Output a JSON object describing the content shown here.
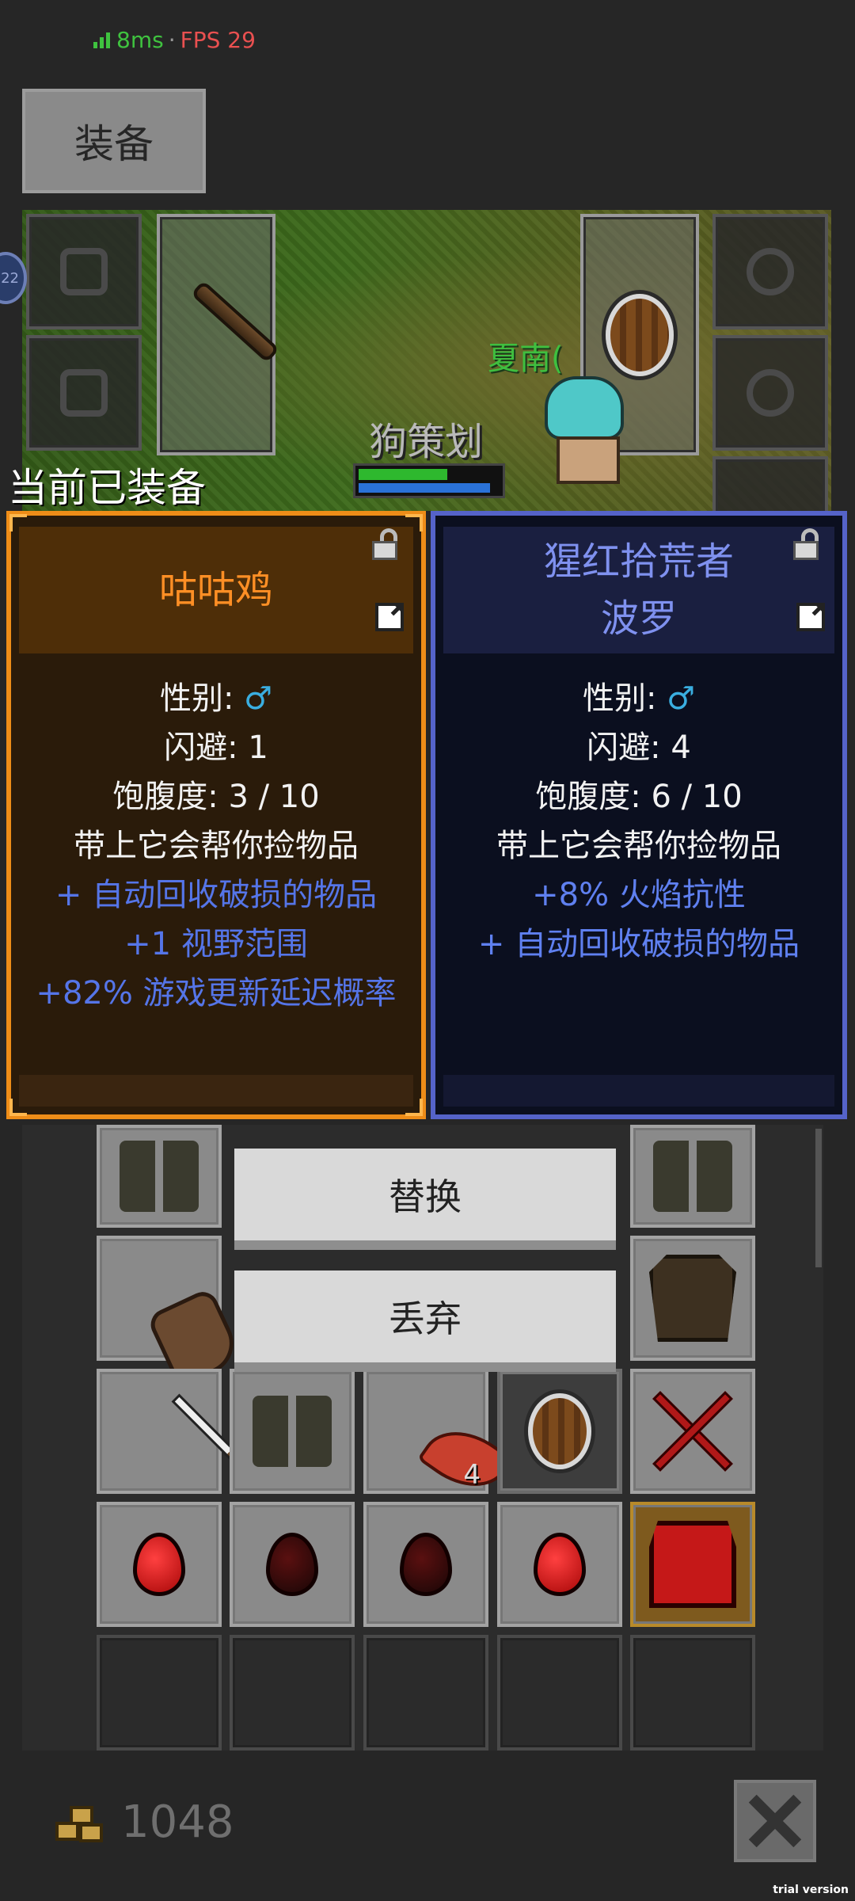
{
  "status": {
    "ping": "8ms",
    "separator": "·",
    "fps": "FPS 29"
  },
  "tab": {
    "label": "装备"
  },
  "scene": {
    "pet_name": "狗策划",
    "player_name": "夏南(",
    "avatar_badge": "22",
    "hp_fraction": 0.63,
    "mp_fraction": 0.93
  },
  "equipped_label": "当前已装备",
  "current_pet": {
    "name": "咕咕鸡",
    "stats": [
      {
        "label": "性别:",
        "symbol": "♂"
      },
      "闪避: 1",
      "饱腹度: 3 / 10",
      "带上它会帮你捡物品"
    ],
    "bonuses": [
      "+ 自动回收破损的物品",
      "+1 视野范围",
      "+82% 游戏更新延迟概率"
    ],
    "border_color": "#ee8d18"
  },
  "new_pet": {
    "name_line1": "猩红拾荒者",
    "name_line2": "波罗",
    "stats": [
      {
        "label": "性别:",
        "symbol": "♂"
      },
      "闪避: 4",
      "饱腹度: 6 / 10",
      "带上它会帮你捡物品"
    ],
    "bonuses": [
      "+8% 火焰抗性",
      "+ 自动回收破损的物品"
    ],
    "border_color": "#5563c9"
  },
  "actions": {
    "replace": "替换",
    "discard": "丢弃"
  },
  "inventory": {
    "leaf_count": "4"
  },
  "footer": {
    "gold": "1048"
  },
  "watermark": "trial version"
}
